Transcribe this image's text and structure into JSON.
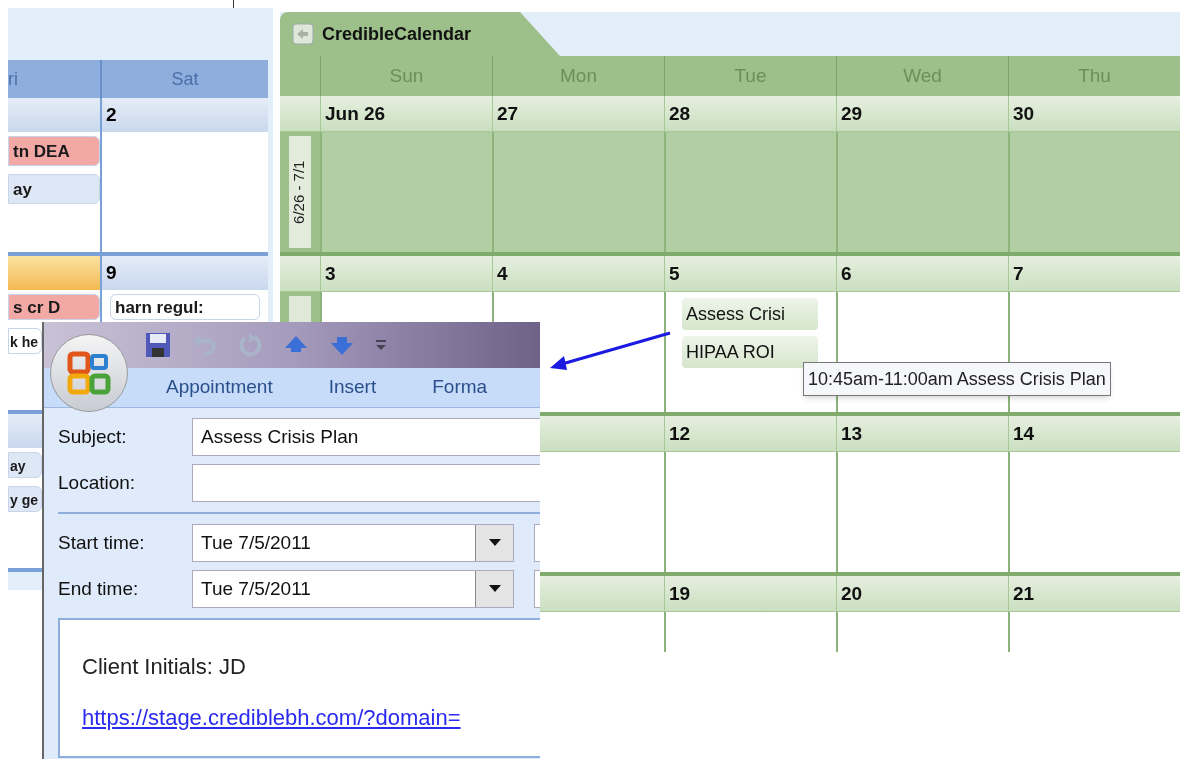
{
  "blue_calendar": {
    "columns": [
      "ri",
      "Sat"
    ],
    "weeks": [
      {
        "days": [
          {
            "today": false,
            "events": [
              {
                "text": "tn DEA",
                "color": "#f2a9a6"
              },
              {
                "text": "ay",
                "color": "#dde7f5"
              }
            ]
          },
          {
            "date": "2",
            "today": false
          }
        ]
      },
      {
        "days": [
          {
            "today": true,
            "events": [
              {
                "text": "s cr D",
                "color": "#f2a9a6"
              },
              {
                "text": "k he",
                "color": "#ffffff"
              }
            ]
          },
          {
            "date": "9",
            "today": false,
            "events": [
              {
                "text": "harn regul:",
                "color": "#ffffff"
              }
            ]
          }
        ]
      },
      {
        "days": [
          {
            "today": false,
            "events": [
              {
                "text": "ay",
                "color": "#dde7f5"
              },
              {
                "text": "y ge",
                "color": "#dde7f5"
              }
            ]
          }
        ]
      }
    ]
  },
  "green_calendar": {
    "tab": "CredibleCalendar",
    "columns": [
      "Sun",
      "Mon",
      "Tue",
      "Wed",
      "Thu"
    ],
    "weeks": [
      {
        "label": "6/26 - 7/1",
        "selected": true,
        "days": [
          {
            "date": "Jun 26"
          },
          {
            "date": "27"
          },
          {
            "date": "28"
          },
          {
            "date": "29"
          },
          {
            "date": "30"
          }
        ]
      },
      {
        "selected": false,
        "days": [
          {
            "date": "3"
          },
          {
            "date": "4"
          },
          {
            "date": "5",
            "events": [
              "Assess Crisi",
              "HIPAA ROI"
            ]
          },
          {
            "date": "6"
          },
          {
            "date": "7"
          }
        ]
      },
      {
        "selected": false,
        "days": [
          {
            "date": "12"
          },
          {
            "date": "13"
          },
          {
            "date": "14"
          }
        ]
      },
      {
        "selected": false,
        "days": [
          {
            "date": "19"
          },
          {
            "date": "20"
          },
          {
            "date": "21"
          }
        ]
      }
    ],
    "tooltip": "10:45am-11:00am Assess Crisis Plan"
  },
  "appointment": {
    "toolbar": [
      {
        "kind": "save",
        "disabled": false
      },
      {
        "kind": "undo",
        "disabled": true
      },
      {
        "kind": "redo",
        "disabled": true
      },
      {
        "kind": "up",
        "disabled": false
      },
      {
        "kind": "down",
        "disabled": false
      },
      {
        "kind": "more",
        "disabled": false
      }
    ],
    "ribbon_tabs": [
      "Appointment",
      "Insert",
      "Forma"
    ],
    "subject": {
      "label": "Subject:",
      "value": "Assess Crisis Plan"
    },
    "location": {
      "label": "Location:"
    },
    "start": {
      "label": "Start time:",
      "value": "Tue 7/5/2011"
    },
    "end": {
      "label": "End time:",
      "value": "Tue 7/5/2011"
    },
    "body": {
      "text": "Client Initials: JD",
      "link": "https://stage.crediblebh.com/?domain="
    }
  }
}
